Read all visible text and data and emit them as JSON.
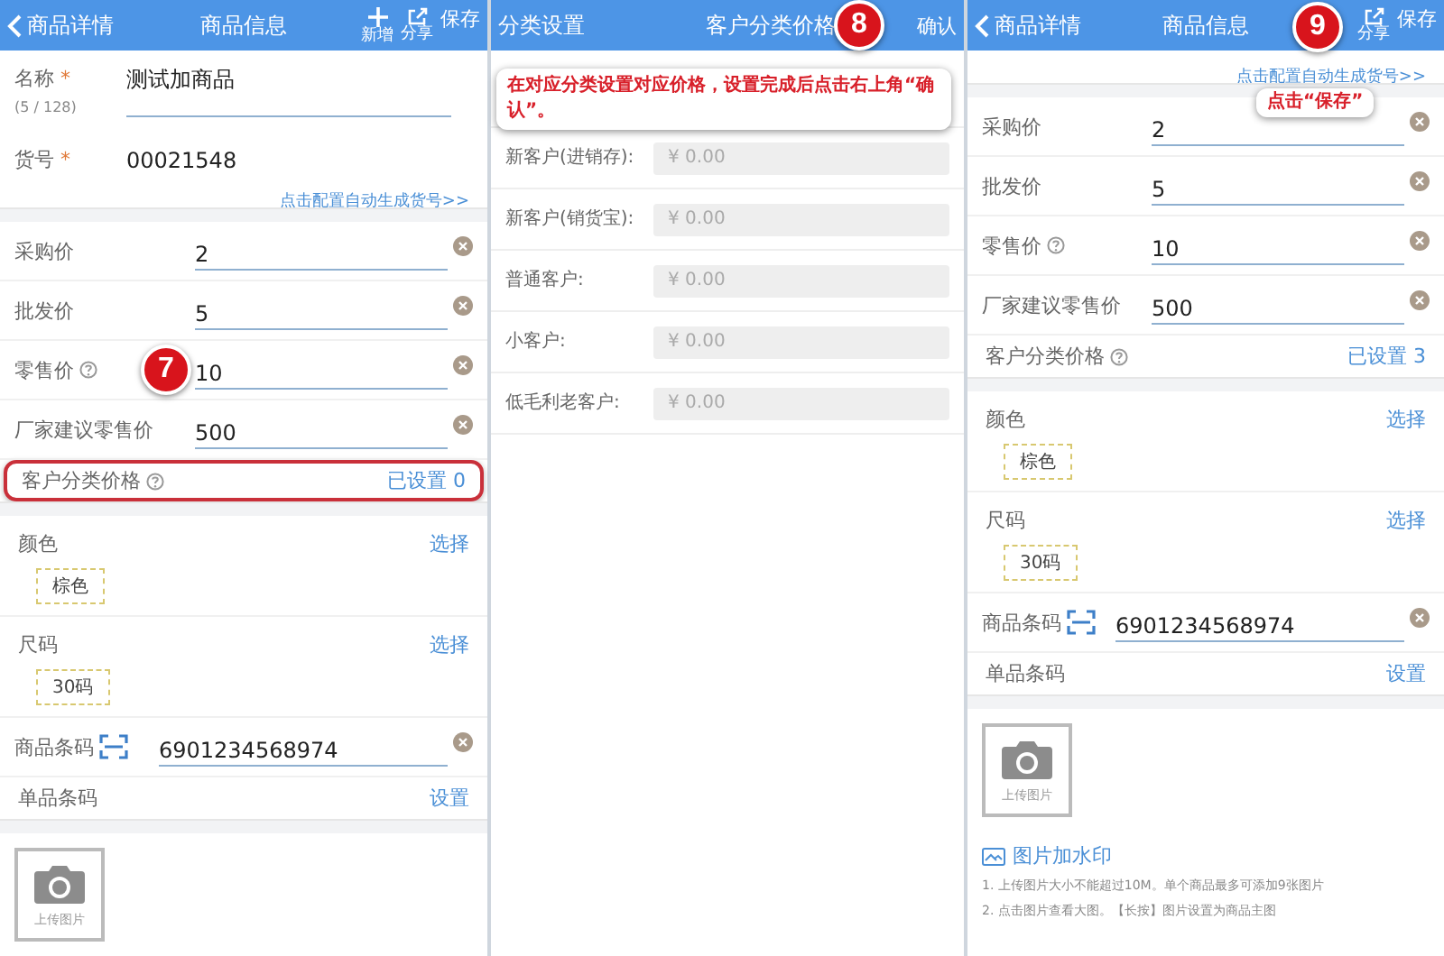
{
  "panels": [
    {
      "kind": "product",
      "header": {
        "back": "商品详情",
        "title": "商品信息",
        "actions": [
          {
            "kind": "add",
            "label": "新增"
          },
          {
            "kind": "share",
            "label": "分享"
          },
          {
            "kind": "text",
            "label": "保存"
          }
        ]
      },
      "name": {
        "label": "名称",
        "required_mark": "*",
        "count": "(5 / 128)",
        "value": "测试加商品"
      },
      "code": {
        "label": "货号",
        "required_mark": "*",
        "value": "00021548"
      },
      "link": "点击配置自动生成货号>>",
      "prices": [
        {
          "label": "采购价",
          "help": false,
          "value": "2"
        },
        {
          "label": "批发价",
          "help": false,
          "value": "5"
        },
        {
          "label": "零售价",
          "help": true,
          "value": "10"
        },
        {
          "label": "厂家建议零售价",
          "help": false,
          "value": "500"
        }
      ],
      "customer_price": {
        "label": "客户分类价格",
        "help": true,
        "value": "已设置 0",
        "highlighted": true
      },
      "specs": [
        {
          "label": "颜色",
          "action": "选择",
          "tag": "棕色"
        },
        {
          "label": "尺码",
          "action": "选择",
          "tag": "30码"
        }
      ],
      "barcode": {
        "label": "商品条码",
        "value": "6901234568974"
      },
      "item_barcode": {
        "label": "单品条码",
        "action": "设置"
      },
      "upload": "上传图片",
      "badge": "7"
    },
    {
      "kind": "category",
      "header": {
        "back": "分类设置",
        "title": "客户分类价格",
        "confirm": "确认"
      },
      "rows": [
        {
          "label": "新客户(进销存):",
          "placeholder": "¥ 0.00"
        },
        {
          "label": "新客户(销货宝):",
          "placeholder": "¥ 0.00"
        },
        {
          "label": "普通客户:",
          "placeholder": "¥ 0.00"
        },
        {
          "label": "小客户:",
          "placeholder": "¥ 0.00"
        },
        {
          "label": "低毛利老客户:",
          "placeholder": "¥ 0.00"
        }
      ],
      "badge": "8",
      "callout": "在对应分类设置对应价格，设置完成后点击右上角“确认”。"
    },
    {
      "kind": "product",
      "header": {
        "back": "商品详情",
        "title": "商品信息",
        "actions": [
          {
            "kind": "share",
            "label": "分享"
          },
          {
            "kind": "text",
            "label": "保存"
          }
        ]
      },
      "link": "点击配置自动生成货号>>",
      "prices": [
        {
          "label": "采购价",
          "help": false,
          "value": "2"
        },
        {
          "label": "批发价",
          "help": false,
          "value": "5"
        },
        {
          "label": "零售价",
          "help": true,
          "value": "10"
        },
        {
          "label": "厂家建议零售价",
          "help": false,
          "value": "500"
        }
      ],
      "customer_price": {
        "label": "客户分类价格",
        "help": true,
        "value": "已设置 3",
        "highlighted": false
      },
      "specs": [
        {
          "label": "颜色",
          "action": "选择",
          "tag": "棕色"
        },
        {
          "label": "尺码",
          "action": "选择",
          "tag": "30码"
        }
      ],
      "barcode": {
        "label": "商品条码",
        "value": "6901234568974"
      },
      "item_barcode": {
        "label": "单品条码",
        "action": "设置"
      },
      "upload": "上传图片",
      "watermark": "图片加水印",
      "notes": [
        "1. 上传图片大小不能超过10M。单个商品最多可添加9张图片",
        "2. 点击图片查看大图。【长按】图片设置为商品主图"
      ],
      "badge": "9",
      "callout": "点击“保存”"
    }
  ]
}
